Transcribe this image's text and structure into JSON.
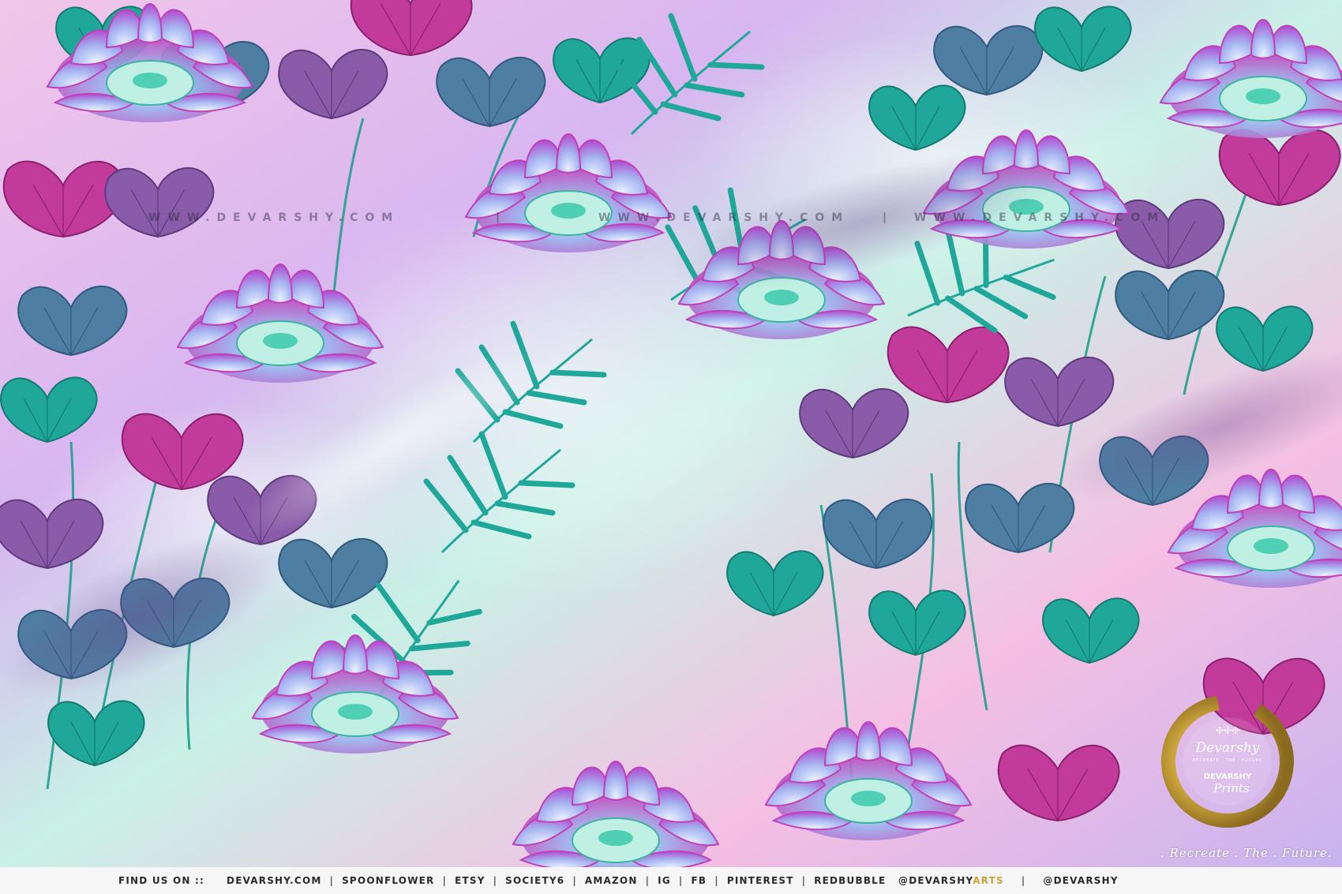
{
  "image": {
    "subject": "satin fabric with tropical lotus floral print",
    "colors": {
      "pink": "#f3b9e4",
      "lilac": "#d9b2f0",
      "mint": "#bff0e3",
      "teal": "#1fa89a",
      "slate_blue": "#4f7ea3",
      "magenta": "#c23a9a",
      "purple": "#8a5ba8",
      "lotus_blue": "#8fb0ee",
      "gold": "#c9a33a"
    }
  },
  "watermark": {
    "text": "WWW.DEVARSHY.COM",
    "separator": "|"
  },
  "logo": {
    "brand": "Devarshy",
    "sub_brand": "DEVARSHY",
    "script": "Prints",
    "tagline_small": "RECREATE . THE . FUTURE"
  },
  "tagline": ". Recreate . The . Future.",
  "footer": {
    "find_us": "FIND US ON ::",
    "links": [
      "DEVARSHY.COM",
      "SPOONFLOWER",
      "ETSY",
      "SOCIETY6",
      "AMAZON",
      "IG",
      "FB",
      "PINTEREST",
      "REDBUBBLE"
    ],
    "separator": "|",
    "handle_1_prefix": "@DEVARSHY",
    "handle_1_suffix": "ARTS",
    "handle_2": "@DEVARSHY"
  }
}
